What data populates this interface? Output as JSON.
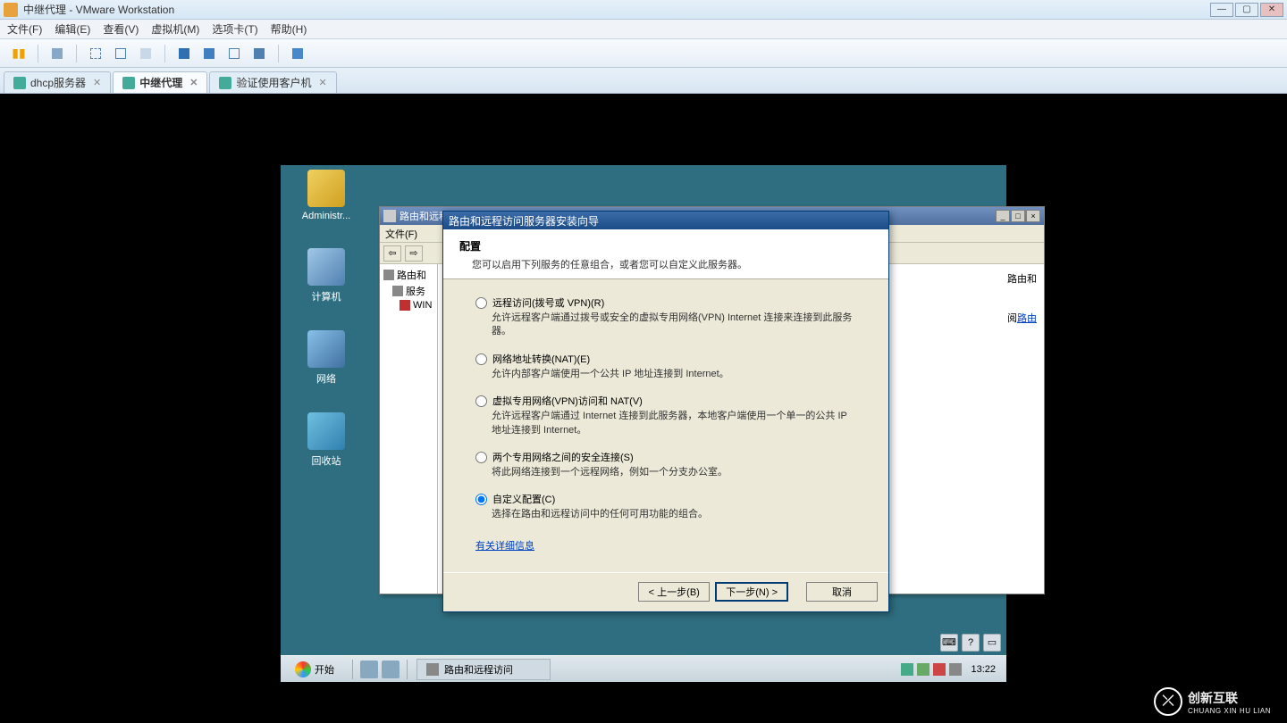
{
  "vmware": {
    "window_title": "中继代理 - VMware Workstation",
    "menu": {
      "file": "文件(F)",
      "edit": "编辑(E)",
      "view": "查看(V)",
      "vm": "虚拟机(M)",
      "tabs": "选项卡(T)",
      "help": "帮助(H)"
    },
    "tabs": [
      {
        "label": "dhcp服务器",
        "active": false
      },
      {
        "label": "中继代理",
        "active": true
      },
      {
        "label": "验证使用客户机",
        "active": false
      }
    ]
  },
  "desktop_icons": {
    "admin": "Administr...",
    "computer": "计算机",
    "network": "网络",
    "recycle": "回收站"
  },
  "mmc": {
    "title_prefix": "路由和远程",
    "file_menu": "文件(F)",
    "tree_root": "路由和",
    "tree_service": "服务",
    "tree_win": "WIN",
    "right_text1": "路由和",
    "right_link": "路由"
  },
  "wizard": {
    "title": "路由和远程访问服务器安装向导",
    "header_title": "配置",
    "header_desc": "您可以启用下列服务的任意组合，或者您可以自定义此服务器。",
    "options": [
      {
        "label": "远程访问(拨号或 VPN)(R)",
        "desc": "允许远程客户端通过拨号或安全的虚拟专用网络(VPN) Internet 连接来连接到此服务器。"
      },
      {
        "label": "网络地址转换(NAT)(E)",
        "desc": "允许内部客户端使用一个公共 IP 地址连接到 Internet。"
      },
      {
        "label": "虚拟专用网络(VPN)访问和 NAT(V)",
        "desc": "允许远程客户端通过 Internet 连接到此服务器，本地客户端使用一个单一的公共 IP 地址连接到 Internet。"
      },
      {
        "label": "两个专用网络之间的安全连接(S)",
        "desc": "将此网络连接到一个远程网络，例如一个分支办公室。"
      },
      {
        "label": "自定义配置(C)",
        "desc": "选择在路由和远程访问中的任何可用功能的组合。"
      }
    ],
    "more_info": "有关详细信息",
    "back": "< 上一步(B)",
    "next": "下一步(N) >",
    "cancel": "取消"
  },
  "taskbar": {
    "start": "开始",
    "task_label": "路由和远程访问",
    "clock": "13:22"
  },
  "brand": {
    "text": "创新互联",
    "sub": "CHUANG XIN HU LIAN"
  },
  "guest_corner": {
    "lang": "⌨",
    "help": "?"
  }
}
